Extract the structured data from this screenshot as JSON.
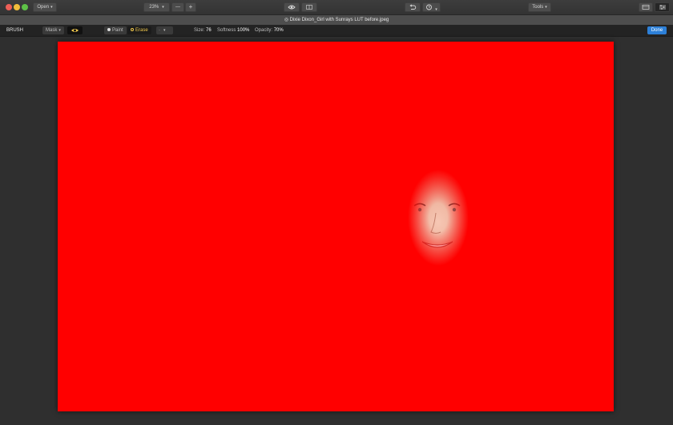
{
  "toolbar": {
    "open_label": "Open",
    "zoom_value": "23%",
    "zoom_out_label": "—",
    "zoom_in_label": "+",
    "tools_label": "Tools"
  },
  "title": "◎ Dixie Dixon_Girl with Sunrays LUT before.jpeg",
  "brush_bar": {
    "mode_label": "BRUSH",
    "mask_label": "Mask",
    "paint_label": "Paint",
    "erase_label": "Erase",
    "size_label": "Size:",
    "size_value": "76",
    "softness_label": "Softness",
    "softness_value": "100%",
    "opacity_label": "Opacity:",
    "opacity_value": "70%",
    "done_label": "Done"
  },
  "colors": {
    "mask_overlay": "#ff0000",
    "done_button": "#2d80d8",
    "erase_active": "#f2c94c"
  },
  "icons": [
    "eye-icon",
    "compare-icon",
    "undo-icon",
    "history-icon",
    "panels-icon",
    "adjustments-icon",
    "paint-dot-icon",
    "erase-dot-icon"
  ]
}
